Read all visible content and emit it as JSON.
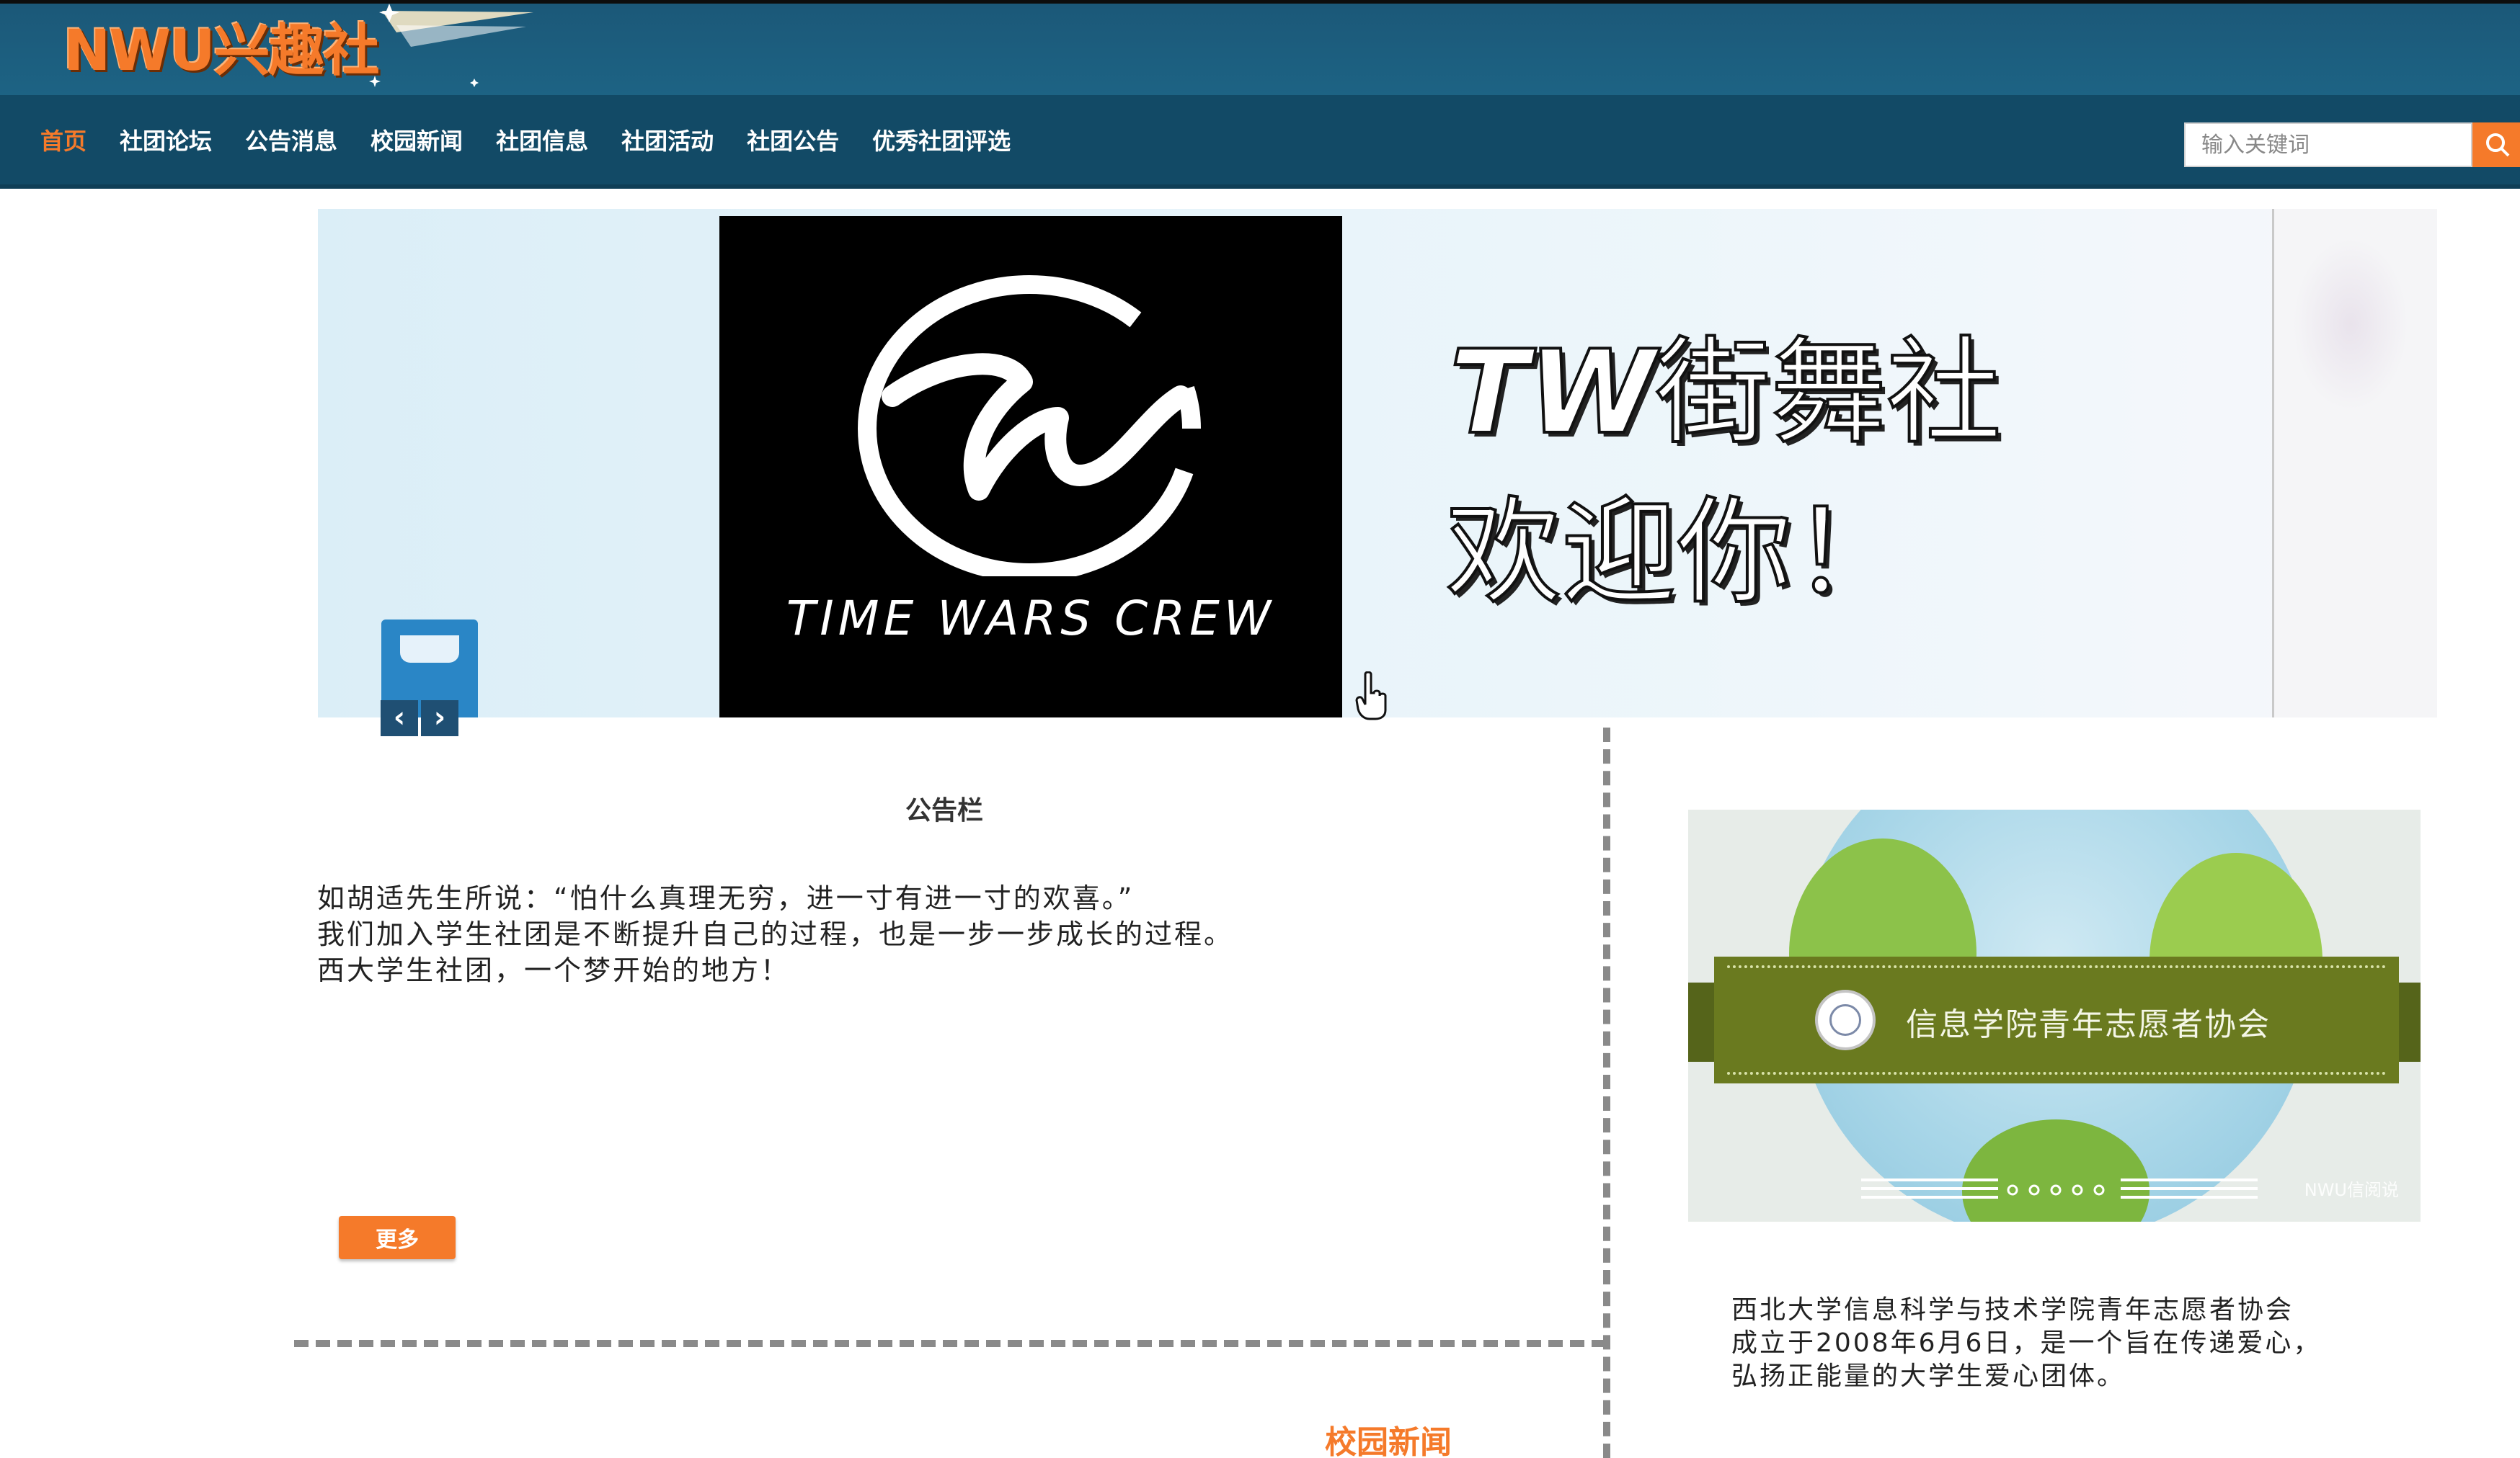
{
  "header": {
    "logo_text": "NWU兴趣社"
  },
  "nav": {
    "items": [
      {
        "label": "首页",
        "active": true
      },
      {
        "label": "社团论坛",
        "active": false
      },
      {
        "label": "公告消息",
        "active": false
      },
      {
        "label": "校园新闻",
        "active": false
      },
      {
        "label": "社团信息",
        "active": false
      },
      {
        "label": "社团活动",
        "active": false
      },
      {
        "label": "社团公告",
        "active": false
      },
      {
        "label": "优秀社团评选",
        "active": false
      }
    ],
    "search": {
      "placeholder": "输入关键词",
      "button_icon": "search-icon"
    }
  },
  "banner": {
    "crew_text": "TIME WARS CREW",
    "title_prefix": "TW",
    "title_rest": "街舞社",
    "subtitle": "欢迎你！",
    "prev_icon": "chevron-left-icon",
    "next_icon": "chevron-right-icon"
  },
  "notice": {
    "title": "公告栏",
    "lines": [
      "如胡适先生所说：“怕什么真理无穷，进一寸有进一寸的欢喜。”",
      "我们加入学生社团是不断提升自己的过程，也是一步一步成长的过程。",
      "西大学生社团，一个梦开始的地方！"
    ],
    "more_label": "更多"
  },
  "association": {
    "ribbon_text": "信息学院青年志愿者协会",
    "watermark": "NWU信阅说",
    "description_lines": [
      "西北大学信息科学与技术学院青年志愿者协会",
      "成立于2008年6月6日，是一个旨在传递爱心，",
      "弘扬正能量的大学生爱心团体。"
    ]
  },
  "news": {
    "heading": "校园新闻"
  },
  "colors": {
    "header_bg": "#1b5878",
    "nav_bg": "#124a66",
    "accent_orange": "#f57a2a"
  }
}
